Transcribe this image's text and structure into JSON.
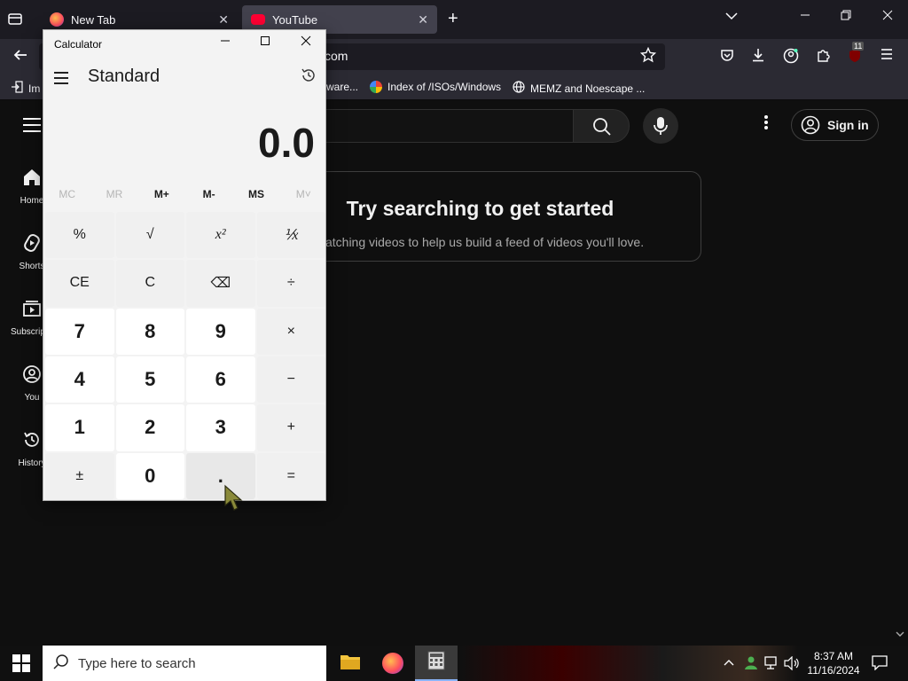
{
  "browser": {
    "tabs": [
      {
        "label": "New Tab",
        "close": "✕"
      },
      {
        "label": "YouTube",
        "close": "✕"
      }
    ],
    "new_tab": "+",
    "url": "com",
    "bookmarks": [
      {
        "label": "Im",
        "icon": "import-icon"
      },
      {
        "label": "ware...",
        "icon": "bookmark-icon"
      },
      {
        "label": "Index of /ISOs/Windows",
        "icon": "google-icon"
      },
      {
        "label": "MEMZ and Noescape ...",
        "icon": "globe-icon"
      }
    ],
    "extension_badge": "11"
  },
  "youtube": {
    "sidebar": [
      {
        "label": "Home",
        "icon": "home-icon"
      },
      {
        "label": "Shorts",
        "icon": "shorts-icon"
      },
      {
        "label": "Subscriptions",
        "icon": "subscriptions-icon"
      },
      {
        "label": "You",
        "icon": "you-icon"
      },
      {
        "label": "History",
        "icon": "history-icon"
      }
    ],
    "sign_in": "Sign in",
    "promo_title": "Try searching to get started",
    "promo_sub": "watching videos to help us build a feed of videos you'll love."
  },
  "calculator": {
    "title": "Calculator",
    "mode": "Standard",
    "display": "0.0",
    "memory": [
      {
        "label": "MC",
        "enabled": false
      },
      {
        "label": "MR",
        "enabled": false
      },
      {
        "label": "M+",
        "enabled": true
      },
      {
        "label": "M-",
        "enabled": true
      },
      {
        "label": "MS",
        "enabled": true
      },
      {
        "label": "M˅",
        "enabled": false
      }
    ],
    "keys": [
      "%",
      "√",
      "x²",
      "⅟x",
      "CE",
      "C",
      "⌫",
      "÷",
      "7",
      "8",
      "9",
      "×",
      "4",
      "5",
      "6",
      "−",
      "1",
      "2",
      "3",
      "+",
      "±",
      "0",
      ".",
      "="
    ]
  },
  "taskbar": {
    "search_placeholder": "Type here to search",
    "time": "8:37 AM",
    "date": "11/16/2024"
  }
}
